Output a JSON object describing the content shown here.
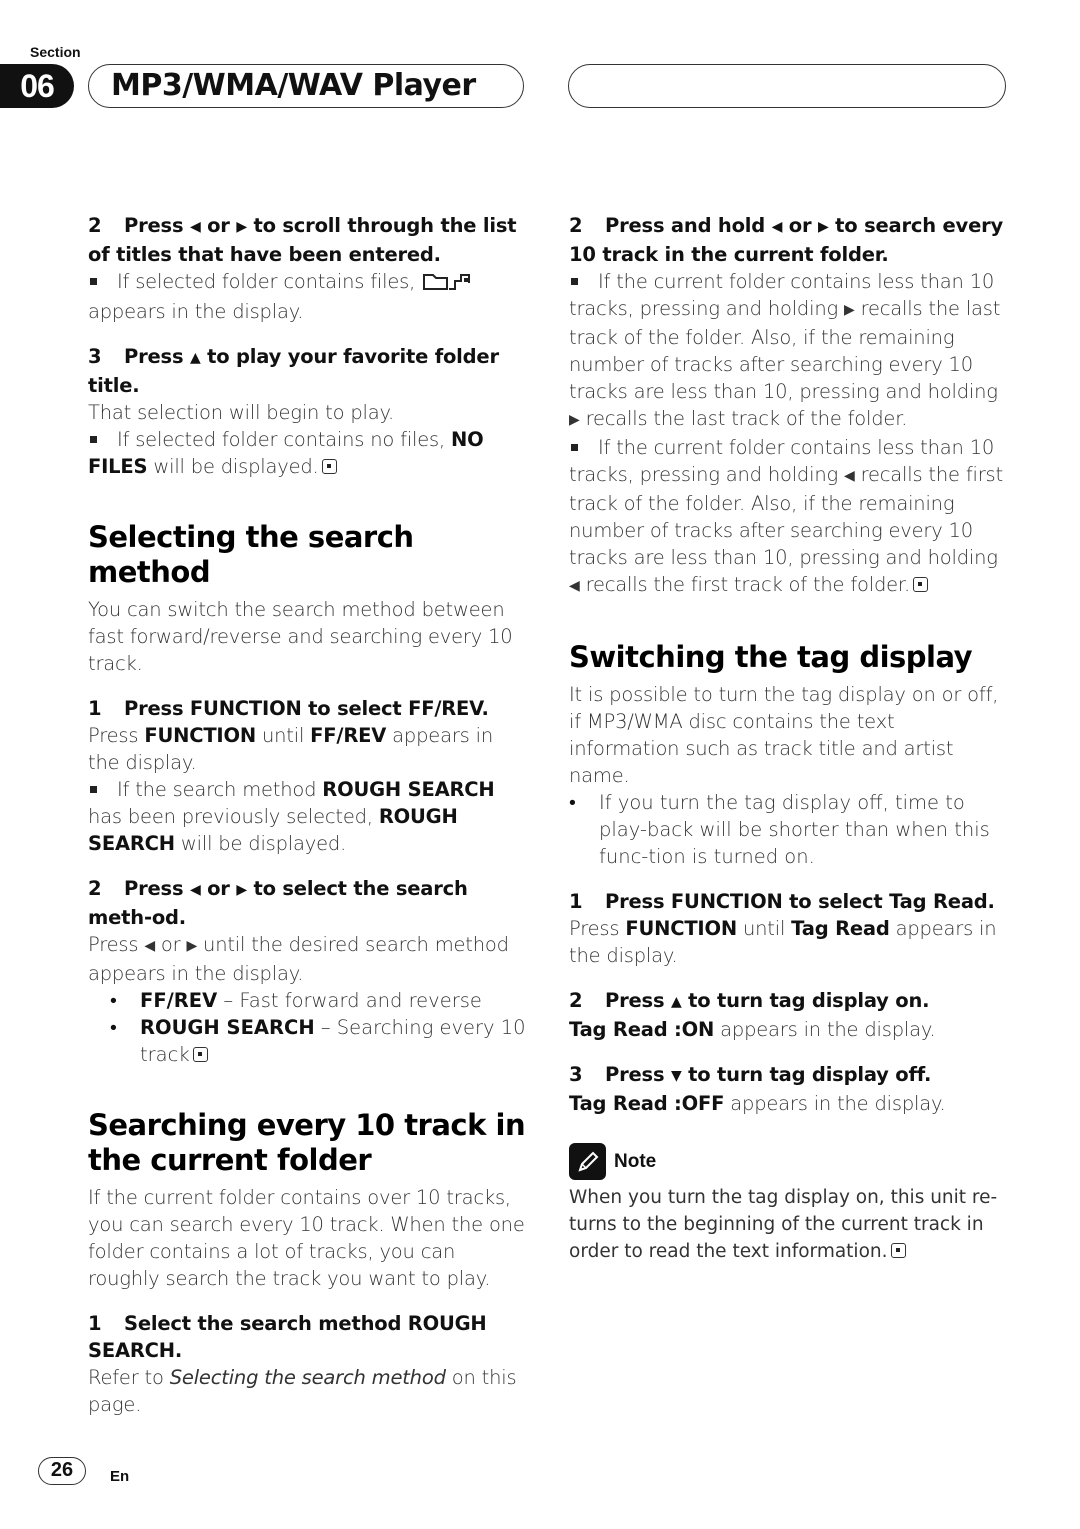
{
  "header": {
    "section_label": "Section",
    "section_number": "06",
    "title": "MP3/WMA/WAV Player"
  },
  "left": {
    "step2_num": "2",
    "step2_title_a": "Press ",
    "step2_title_b": " or ",
    "step2_title_c": " to scroll through the list of titles that have been entered.",
    "step2_note_a": "If selected folder contains files, ",
    "step2_note_b": " appears in the display.",
    "step3_num": "3",
    "step3_title_a": "Press ",
    "step3_title_b": " to play your favorite folder title.",
    "step3_body": "That selection will begin to play.",
    "step3_note_a": "If selected folder contains no files, ",
    "step3_note_bold": "NO FILES",
    "step3_note_b": " will be displayed.",
    "sec1_heading": "Selecting the search method",
    "sec1_intro": "You can switch the search method between fast forward/reverse and searching every 10 track.",
    "sec1_step1_num": "1",
    "sec1_step1_title": "Press FUNCTION to select FF/REV.",
    "sec1_step1_body_a": "Press ",
    "sec1_step1_body_b1": "FUNCTION",
    "sec1_step1_body_c": " until ",
    "sec1_step1_body_b2": "FF/REV",
    "sec1_step1_body_d": " appears in the display.",
    "sec1_step1_note_a": "If the search method ",
    "sec1_step1_note_b1": "ROUGH SEARCH",
    "sec1_step1_note_c": " has been previously selected, ",
    "sec1_step1_note_b2": "ROUGH SEARCH",
    "sec1_step1_note_d": " will be displayed.",
    "sec1_step2_num": "2",
    "sec1_step2_title_a": "Press ",
    "sec1_step2_title_b": " or ",
    "sec1_step2_title_c": " to select the search meth-od.",
    "sec1_step2_body_a": "Press ",
    "sec1_step2_body_b": " or ",
    "sec1_step2_body_c": " until the desired search method appears in the display.",
    "sec1_options": [
      {
        "label": "FF/REV",
        "desc": " – Fast forward and reverse"
      },
      {
        "label": "ROUGH SEARCH",
        "desc": " – Searching every 10 track"
      }
    ],
    "sec2_heading": "Searching every 10 track in the current folder",
    "sec2_intro": "If the current folder contains over 10 tracks, you can search every 10 track. When the one folder contains a lot of tracks, you can roughly search the track you want to play.",
    "sec2_step1_num": "1",
    "sec2_step1_title": "Select the search method ROUGH SEARCH.",
    "sec2_step1_body_a": "Refer to ",
    "sec2_step1_body_italic": "Selecting the search method",
    "sec2_step1_body_b": " on this page."
  },
  "right": {
    "step2_num": "2",
    "step2_title_a": "Press and hold ",
    "step2_title_b": " or ",
    "step2_title_c": " to search every 10 track in the current folder.",
    "note1_a": "If the current folder contains less than 10 tracks, pressing and holding ",
    "note1_b": " recalls the last track of the folder. Also, if the remaining number of tracks after searching every 10 tracks are less than 10, pressing and holding ",
    "note1_c": " recalls the last track of the folder.",
    "note2_a": "If the current folder contains less than 10 tracks, pressing and holding ",
    "note2_b": " recalls the first track of the folder. Also, if the remaining number of tracks after searching every 10 tracks are less than 10, pressing and holding ",
    "note2_c": " recalls the first track of the folder.",
    "sec3_heading": "Switching the tag display",
    "sec3_intro": "It is possible to turn the tag display on or off, if MP3/WMA disc contains the text information such as track title and artist name.",
    "sec3_bullet": "If you turn the tag display off, time to play-back will be shorter than when this func-tion is turned on.",
    "sec3_step1_num": "1",
    "sec3_step1_title": "Press FUNCTION to select Tag Read.",
    "sec3_step1_body_a": "Press ",
    "sec3_step1_body_b1": "FUNCTION",
    "sec3_step1_body_c": " until ",
    "sec3_step1_body_b2": "Tag Read",
    "sec3_step1_body_d": " appears in the display.",
    "sec3_step2_num": "2",
    "sec3_step2_title_a": "Press ",
    "sec3_step2_title_b": " to turn tag display on.",
    "sec3_step2_body_bold": "Tag Read :ON",
    "sec3_step2_body": " appears in the display.",
    "sec3_step3_num": "3",
    "sec3_step3_title_a": "Press ",
    "sec3_step3_title_b": " to turn tag display off.",
    "sec3_step3_body_bold": "Tag Read :OFF",
    "sec3_step3_body": " appears in the display.",
    "note_label": "Note",
    "note_text": "When you turn the tag display on, this unit re-turns to the beginning of the current track in order to read the text information."
  },
  "glyphs": {
    "left": "◀",
    "right": "▶",
    "up": "▲",
    "down": "▼",
    "bullet": "•"
  },
  "footer": {
    "page_number": "26",
    "language": "En"
  }
}
